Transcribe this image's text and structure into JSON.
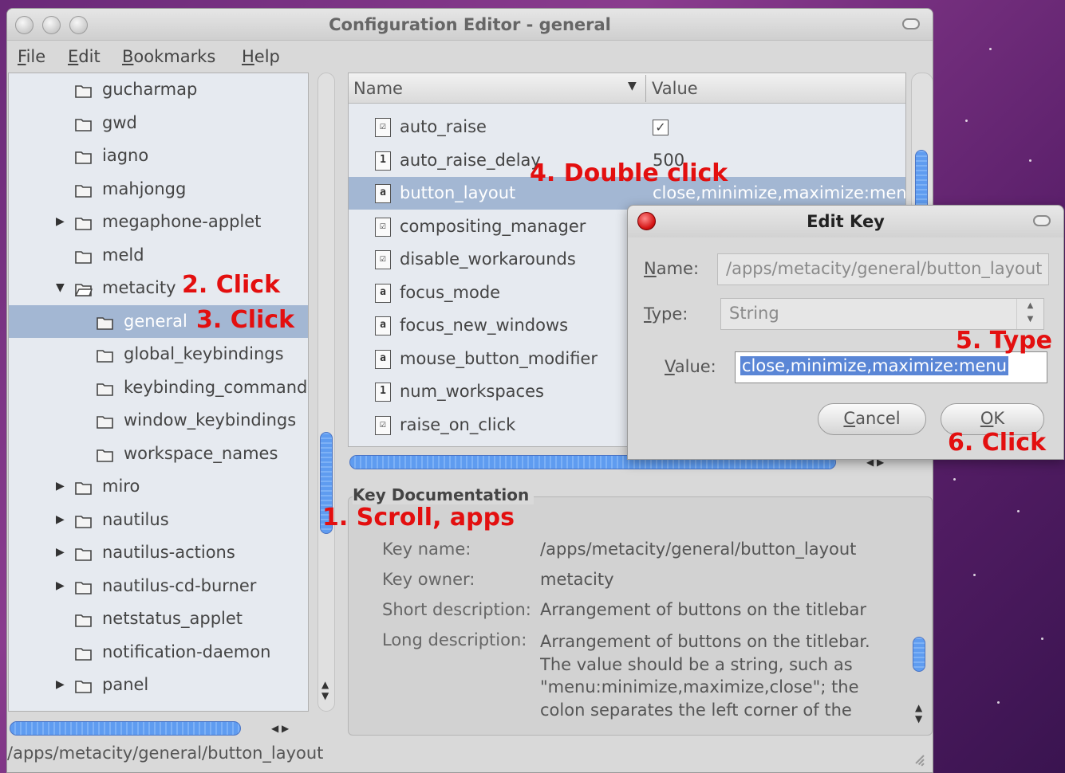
{
  "window": {
    "title": "Configuration Editor - general"
  },
  "menu": [
    {
      "label": "File"
    },
    {
      "label": "Edit"
    },
    {
      "label": "Bookmarks"
    },
    {
      "label": "Help"
    }
  ],
  "tree": {
    "items": [
      {
        "label": "gucharmap",
        "indent": 0,
        "expander": "",
        "open": false
      },
      {
        "label": "gwd",
        "indent": 0,
        "expander": "",
        "open": false
      },
      {
        "label": "iagno",
        "indent": 0,
        "expander": "",
        "open": false
      },
      {
        "label": "mahjongg",
        "indent": 0,
        "expander": "",
        "open": false
      },
      {
        "label": "megaphone-applet",
        "indent": 0,
        "expander": "right",
        "open": false
      },
      {
        "label": "meld",
        "indent": 0,
        "expander": "",
        "open": false
      },
      {
        "label": "metacity",
        "indent": 0,
        "expander": "down",
        "open": true
      },
      {
        "label": "general",
        "indent": 1,
        "expander": "",
        "open": false,
        "selected": true
      },
      {
        "label": "global_keybindings",
        "indent": 1,
        "expander": "",
        "open": false
      },
      {
        "label": "keybinding_commands",
        "indent": 1,
        "expander": "",
        "open": false
      },
      {
        "label": "window_keybindings",
        "indent": 1,
        "expander": "",
        "open": false
      },
      {
        "label": "workspace_names",
        "indent": 1,
        "expander": "",
        "open": false
      },
      {
        "label": "miro",
        "indent": 0,
        "expander": "right",
        "open": false
      },
      {
        "label": "nautilus",
        "indent": 0,
        "expander": "right",
        "open": false
      },
      {
        "label": "nautilus-actions",
        "indent": 0,
        "expander": "right",
        "open": false
      },
      {
        "label": "nautilus-cd-burner",
        "indent": 0,
        "expander": "right",
        "open": false
      },
      {
        "label": "netstatus_applet",
        "indent": 0,
        "expander": "",
        "open": false
      },
      {
        "label": "notification-daemon",
        "indent": 0,
        "expander": "",
        "open": false
      },
      {
        "label": "panel",
        "indent": 0,
        "expander": "right",
        "open": false
      }
    ]
  },
  "list": {
    "header_name": "Name",
    "header_value": "Value",
    "rows": [
      {
        "name": "auto_raise",
        "value": "",
        "type_icon": "boolean-icon",
        "glyph": "☑",
        "checked": true
      },
      {
        "name": "auto_raise_delay",
        "value": "500",
        "type_icon": "integer-icon",
        "glyph": "1"
      },
      {
        "name": "button_layout",
        "value": "close,minimize,maximize:menu",
        "type_icon": "string-icon",
        "glyph": "a",
        "selected": true
      },
      {
        "name": "compositing_manager",
        "value": "",
        "type_icon": "boolean-icon",
        "glyph": "☑"
      },
      {
        "name": "disable_workarounds",
        "value": "",
        "type_icon": "boolean-icon",
        "glyph": "☑"
      },
      {
        "name": "focus_mode",
        "value": "",
        "type_icon": "string-icon",
        "glyph": "a"
      },
      {
        "name": "focus_new_windows",
        "value": "",
        "type_icon": "string-icon",
        "glyph": "a"
      },
      {
        "name": "mouse_button_modifier",
        "value": "",
        "type_icon": "string-icon",
        "glyph": "a"
      },
      {
        "name": "num_workspaces",
        "value": "",
        "type_icon": "integer-icon",
        "glyph": "1"
      },
      {
        "name": "raise_on_click",
        "value": "",
        "type_icon": "boolean-icon",
        "glyph": "☑"
      }
    ]
  },
  "doc": {
    "title": "Key Documentation",
    "key_name_label": "Key name:",
    "key_name": "/apps/metacity/general/button_layout",
    "key_owner_label": "Key owner:",
    "key_owner": "metacity",
    "short_label": "Short description:",
    "short": "Arrangement of buttons on the titlebar",
    "long_label": "Long description:",
    "long": "Arrangement of buttons on the titlebar. The value should be a string, such as \"menu:minimize,maximize,close\"; the colon separates the left corner of the window from the right corner, and the"
  },
  "status": "/apps/metacity/general/button_layout",
  "dialog": {
    "title": "Edit Key",
    "name_label": "Name:",
    "name_value": "/apps/metacity/general/button_layout",
    "type_label": "Type:",
    "type_value": "String",
    "value_label": "Value:",
    "value": "close,minimize,maximize:menu",
    "cancel": "Cancel",
    "ok": "OK"
  },
  "annotations": {
    "a1": "1. Scroll, apps",
    "a2": "2. Click",
    "a3": "3. Click",
    "a4": "4. Double click",
    "a5": "5. Type",
    "a6": "6. Click"
  },
  "colors": {
    "selection": "#a3b7d3",
    "scroll_thumb": "#5f9cf0",
    "annotation": "#e30f0f",
    "desktop": "#6a2a78"
  }
}
